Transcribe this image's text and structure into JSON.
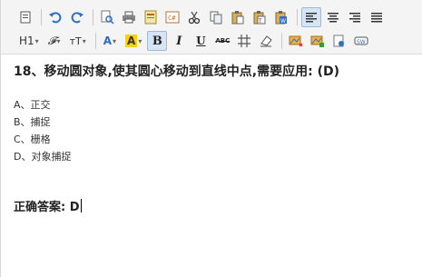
{
  "toolbar": {
    "heading_label": "H1",
    "font_family_label": "𝓕",
    "font_size_label": "тT",
    "font_color_label": "A",
    "highlight_label": "A",
    "bold_label": "B",
    "italic_label": "I",
    "underline_label": "U",
    "strike_label": "ABC",
    "colors": {
      "accent_blue": "#2e6fc4",
      "highlight_yellow": "#f7d117",
      "active_bg": "#d6e4f4"
    }
  },
  "question": {
    "text": "18、移动圆对象,使其圆心移动到直线中点,需要应用: (D)"
  },
  "options": [
    {
      "text": "A、正交"
    },
    {
      "text": "B、捕捉"
    },
    {
      "text": "C、栅格"
    },
    {
      "text": "D、对象捕捉"
    }
  ],
  "answer": {
    "label": "正确答案: ",
    "value": "D"
  }
}
